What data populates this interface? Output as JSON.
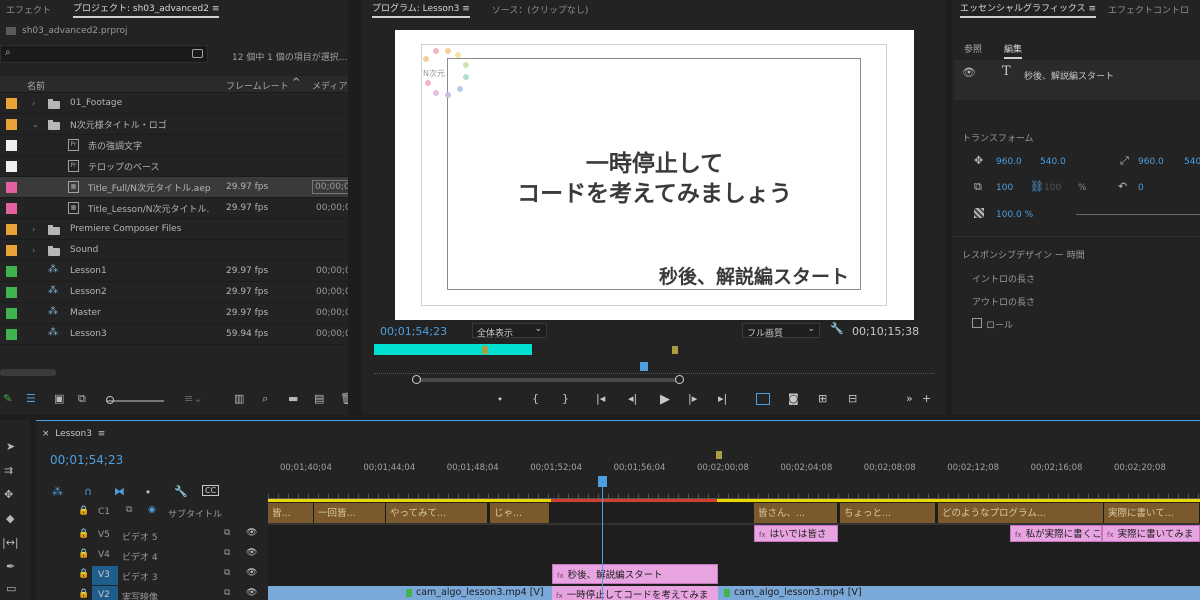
{
  "project_panel": {
    "tab_effects": "エフェクト",
    "tab_project": "プロジェクト: sh03_advanced2",
    "menu_icon": "≡",
    "file_name": "sh03_advanced2.prproj",
    "selection_info": "12 個中 1 個の項目が選択...",
    "col_name": "名前",
    "col_framerate": "フレームレート",
    "col_media": "メディア",
    "items": [
      {
        "name": "01_Footage",
        "fps": "",
        "tc": "",
        "color": "#e8a236",
        "type": "folder",
        "indent": 0,
        "expand": "closed"
      },
      {
        "name": "N次元様タイトル・ロゴ",
        "fps": "",
        "tc": "",
        "color": "#e8a236",
        "type": "folder",
        "indent": 0,
        "expand": "open"
      },
      {
        "name": "赤の強調文字",
        "fps": "",
        "tc": "",
        "color": "#f0f0f0",
        "type": "file",
        "indent": 1,
        "expand": ""
      },
      {
        "name": "テロップのベース",
        "fps": "",
        "tc": "",
        "color": "#f0f0f0",
        "type": "file",
        "indent": 1,
        "expand": ""
      },
      {
        "name": "Title_Full/N次元タイトル.aep",
        "fps": "29.97 fps",
        "tc": "00;00;0",
        "color": "#e45fa0",
        "type": "comp",
        "indent": 1,
        "expand": ""
      },
      {
        "name": "Title_Lesson/N次元タイトル.",
        "fps": "29.97 fps",
        "tc": "00;00;0",
        "color": "#e45fa0",
        "type": "comp",
        "indent": 1,
        "expand": ""
      },
      {
        "name": "Premiere Composer Files",
        "fps": "",
        "tc": "",
        "color": "#e8a236",
        "type": "folder",
        "indent": 0,
        "expand": "closed"
      },
      {
        "name": "Sound",
        "fps": "",
        "tc": "",
        "color": "#e8a236",
        "type": "folder",
        "indent": 0,
        "expand": "closed"
      },
      {
        "name": "Lesson1",
        "fps": "29.97 fps",
        "tc": "00;00;0",
        "color": "#3fb34f",
        "type": "seq",
        "indent": 0,
        "expand": ""
      },
      {
        "name": "Lesson2",
        "fps": "29.97 fps",
        "tc": "00;00;0",
        "color": "#3fb34f",
        "type": "seq",
        "indent": 0,
        "expand": ""
      },
      {
        "name": "Master",
        "fps": "29.97 fps",
        "tc": "00;00;0",
        "color": "#3fb34f",
        "type": "seq",
        "indent": 0,
        "expand": ""
      },
      {
        "name": "Lesson3",
        "fps": "59.94 fps",
        "tc": "00;00;0",
        "color": "#3fb34f",
        "type": "seq",
        "indent": 0,
        "expand": ""
      }
    ]
  },
  "program_monitor": {
    "tab_program": "プログラム: Lesson3",
    "menu_icon": "≡",
    "tab_source": "ソース：(クリップなし)",
    "canvas_main_line1": "一時停止して",
    "canvas_main_line2": "コードを考えてみましょう",
    "canvas_sub": "秒後、解説編スタート",
    "logo_text": "N次元",
    "current_tc": "00;01;54;23",
    "fit_select": "全体表示",
    "quality_select": "フル画質",
    "duration_tc": "00;10;15;38"
  },
  "essential_graphics": {
    "tab_eg": "エッセンシャルグラフィックス",
    "menu_icon": "≡",
    "tab_effect_controls": "エフェクトコントロ",
    "sub_browse": "参照",
    "sub_edit": "編集",
    "layer_name": "秒後、解説編スタート",
    "transform_label": "トランスフォーム",
    "pos_x": "960.0",
    "pos_y": "540.0",
    "anchor_x": "960.0",
    "anchor_y": "540",
    "scale": "100",
    "scale2": "100",
    "percent": "%",
    "rotation": "0",
    "opacity": "100.0 %",
    "responsive_label": "レスポンシブデザイン ー 時間",
    "intro_label": "イントロの長さ",
    "outro_label": "アウトロの長さ",
    "roll_label": "ロール"
  },
  "timeline": {
    "close_icon": "×",
    "seq_tab": "Lesson3",
    "menu_icon": "≡",
    "current_tc": "00;01;54;23",
    "ruler_labels": [
      "00;01;40;04",
      "00;01;44;04",
      "00;01;48;04",
      "00;01;52;04",
      "00;01;56;04",
      "00;02;00;08",
      "00;02;04;08",
      "00;02;08;08",
      "00;02;12;08",
      "00;02;16;08",
      "00;02;20;08"
    ],
    "caption_track": {
      "name": "C1",
      "label": "サブタイトル"
    },
    "tracks": [
      {
        "name": "V5",
        "label": "ビデオ 5"
      },
      {
        "name": "V4",
        "label": "ビデオ 4"
      },
      {
        "name": "V3",
        "label": "ビデオ 3"
      },
      {
        "name": "V2",
        "label": "実写映像"
      }
    ],
    "caption_clips": [
      "皆...",
      "一回皆...",
      "やってみて...",
      "じゃ...",
      "皆さん、...",
      "ちょっと...",
      "どのようなプログラム...",
      "実際に書いて..."
    ],
    "v5_clips": [
      "はいでは皆さ",
      "私が実際に書くこ",
      "実際に書いてみま"
    ],
    "v3_clip": "秒後、解説編スタート",
    "v2_clips": [
      "cam_algo_lesson3.mp4 [V]",
      "一時停止してコードを考えてみま",
      "cam_algo_lesson3.mp4 [V]"
    ],
    "fx_badge": "fx"
  }
}
